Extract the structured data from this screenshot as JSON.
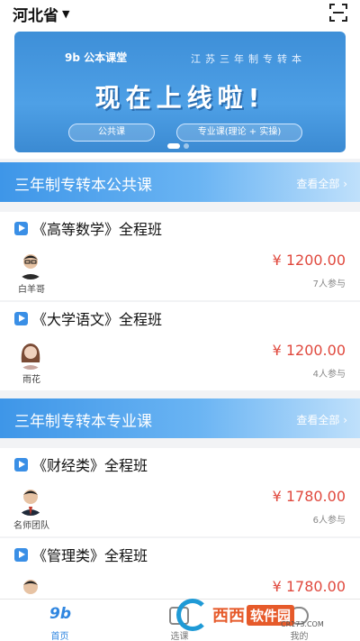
{
  "header": {
    "province": "河北省"
  },
  "banner": {
    "logo": "9b 公本课堂",
    "subtitle": "江苏三年制专转本",
    "headline": "现在上线啦!",
    "pill_left": "公共课",
    "pill_right": "专业课(理论 + 实操)"
  },
  "sections": [
    {
      "title": "三年制专转本公共课",
      "more": "查看全部 ›",
      "courses": [
        {
          "title": "《高等数学》全程班",
          "teacher": "白羊哥",
          "price": "¥ 1200.00",
          "count": "7人参与"
        },
        {
          "title": "《大学语文》全程班",
          "teacher": "雨花",
          "price": "¥ 1200.00",
          "count": "4人参与"
        }
      ]
    },
    {
      "title": "三年制专转本专业课",
      "more": "查看全部 ›",
      "courses": [
        {
          "title": "《财经类》全程班",
          "teacher": "名师团队",
          "price": "¥ 1780.00",
          "count": "6人参与"
        },
        {
          "title": "《管理类》全程班",
          "teacher": "",
          "price": "¥ 1780.00",
          "count": ""
        }
      ]
    }
  ],
  "tabbar": {
    "home_icon": "9b",
    "tabs": [
      {
        "label": "首页"
      },
      {
        "label": "选课"
      },
      {
        "label": "我的"
      }
    ]
  },
  "watermark": {
    "brand": "西西",
    "name": "软件园",
    "url": "CR173.COM"
  },
  "colors": {
    "accent": "#2f86e0",
    "price": "#e0493e"
  }
}
